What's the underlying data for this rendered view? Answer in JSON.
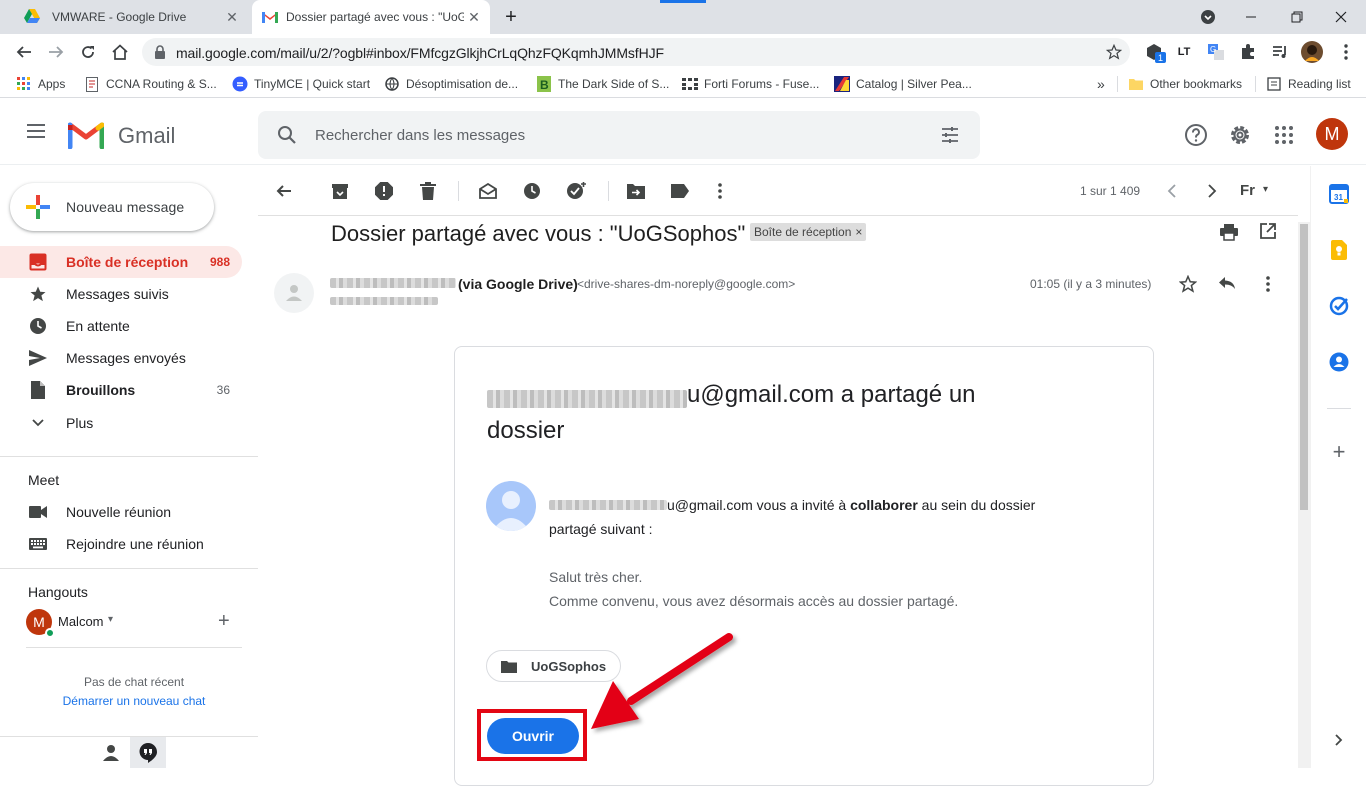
{
  "browser": {
    "tabs": [
      {
        "title": "VMWARE - Google Drive",
        "icon": "google-drive-icon",
        "active": false
      },
      {
        "title": "Dossier partagé avec vous : \"UoG",
        "icon": "gmail-icon",
        "active": true
      }
    ],
    "new_tab_symbol": "+",
    "url": "mail.google.com/mail/u/2/?ogbl#inbox/FMfcgzGlkjhCrLqQhzFQKqmhJMMsfHJF",
    "bookmarks": [
      {
        "label": "Apps",
        "icon": "apps-grid-icon"
      },
      {
        "label": "CCNA Routing & S...",
        "icon": "document-icon"
      },
      {
        "label": "TinyMCE | Quick start",
        "icon": "tinymce-icon"
      },
      {
        "label": "Désoptimisation de...",
        "icon": "globe-icon"
      },
      {
        "label": "The Dark Side of S...",
        "icon": "green-b-icon"
      },
      {
        "label": "Forti Forums - Fuse...",
        "icon": "forum-icon"
      },
      {
        "label": "Catalog | Silver Pea...",
        "icon": "catalog-icon"
      }
    ],
    "bookmarks_more": "»",
    "other_bookmarks": "Other bookmarks",
    "reading_list": "Reading list",
    "extension_badge": "1"
  },
  "gmail": {
    "logo_text": "Gmail",
    "search_placeholder": "Rechercher dans les messages",
    "avatar_letter": "M",
    "compose_label": "Nouveau message",
    "nav": [
      {
        "label": "Boîte de réception",
        "count": "988",
        "icon": "inbox-icon",
        "active": true,
        "bold": true
      },
      {
        "label": "Messages suivis",
        "count": "",
        "icon": "star-icon",
        "active": false,
        "bold": false
      },
      {
        "label": "En attente",
        "count": "",
        "icon": "clock-icon",
        "active": false,
        "bold": false
      },
      {
        "label": "Messages envoyés",
        "count": "",
        "icon": "send-icon",
        "active": false,
        "bold": false
      },
      {
        "label": "Brouillons",
        "count": "36",
        "icon": "draft-icon",
        "active": false,
        "bold": true
      },
      {
        "label": "Plus",
        "count": "",
        "icon": "chevron-down-icon",
        "active": false,
        "bold": false
      }
    ],
    "meet": {
      "title": "Meet",
      "items": [
        {
          "label": "Nouvelle réunion",
          "icon": "video-icon"
        },
        {
          "label": "Rejoindre une réunion",
          "icon": "keyboard-icon"
        }
      ]
    },
    "hangouts": {
      "title": "Hangouts",
      "user": "Malcom",
      "avatar_letter": "M",
      "no_chat": "Pas de chat récent",
      "start_chat": "Démarrer un nouveau chat"
    },
    "pagination": "1 sur 1 409",
    "lang_label": "Fr",
    "message": {
      "subject": "Dossier partagé avec vous : \"UoGSophos\"",
      "label_chip": "Boîte de réception",
      "label_chip_close": "×",
      "sender_via": "(via Google Drive)",
      "sender_email": "<drive-shares-dm-noreply@google.com>",
      "time": "01:05 (il y a 3 minutes)",
      "card": {
        "headline_suffix": "u@gmail.com a partagé un",
        "headline_line2": "dossier",
        "invite_email_suffix": "u@gmail.com vous a invité à ",
        "invite_bold": "collaborer",
        "invite_rest": " au sein du dossier",
        "invite_line2": "partagé suivant :",
        "note_line1": "Salut très cher.",
        "note_line2": "Comme convenu, vous avez désormais accès au dossier partagé.",
        "folder_name": "UoGSophos",
        "open_button": "Ouvrir"
      }
    }
  },
  "colors": {
    "accent_blue": "#1a73e8",
    "inbox_red": "#d93025",
    "annotation_red": "#e30613",
    "avatar_brown": "#bf360c"
  }
}
